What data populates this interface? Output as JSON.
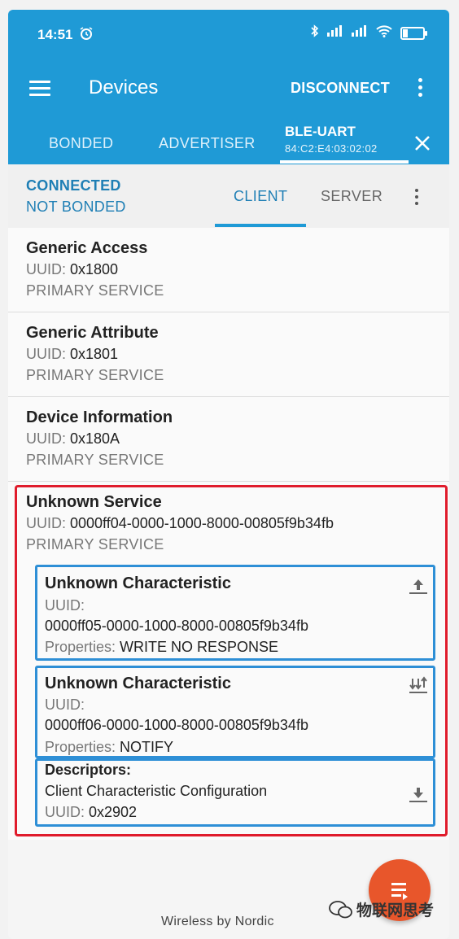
{
  "status_bar": {
    "time": "14:51",
    "battery": "24"
  },
  "app_bar": {
    "title": "Devices",
    "disconnect_label": "DISCONNECT"
  },
  "tabs": {
    "bonded": "BONDED",
    "advertiser": "ADVERTISER",
    "active_device_name": "BLE-UART",
    "active_device_address": "84:C2:E4:03:02:02"
  },
  "connection": {
    "state": "CONNECTED",
    "bond_state": "NOT BONDED",
    "client_tab": "CLIENT",
    "server_tab": "SERVER"
  },
  "services": [
    {
      "name": "Generic Access",
      "uuid_label": "UUID: ",
      "uuid": "0x1800",
      "type": "PRIMARY SERVICE"
    },
    {
      "name": "Generic Attribute",
      "uuid_label": "UUID: ",
      "uuid": "0x1801",
      "type": "PRIMARY SERVICE"
    },
    {
      "name": "Device Information",
      "uuid_label": "UUID: ",
      "uuid": "0x180A",
      "type": "PRIMARY SERVICE"
    },
    {
      "name": "Unknown Service",
      "uuid_label": "UUID: ",
      "uuid": "0000ff04-0000-1000-8000-00805f9b34fb",
      "type": "PRIMARY SERVICE"
    }
  ],
  "characteristics": [
    {
      "name": "Unknown Characteristic",
      "uuid_label": "UUID:",
      "uuid": "0000ff05-0000-1000-8000-00805f9b34fb",
      "properties_label": "Properties: ",
      "properties": "WRITE NO RESPONSE",
      "icon": "upload-arrow-icon"
    },
    {
      "name": "Unknown Characteristic",
      "uuid_label": "UUID:",
      "uuid": "0000ff06-0000-1000-8000-00805f9b34fb",
      "properties_label": "Properties: ",
      "properties": "NOTIFY",
      "icon": "notify-arrows-icon"
    }
  ],
  "descriptor": {
    "heading": "Descriptors:",
    "name": "Client Characteristic Configuration",
    "uuid_label": "UUID: ",
    "uuid": "0x2902",
    "icon": "download-arrow-icon"
  },
  "footer": {
    "text": "Wireless by Nordic"
  },
  "watermark": {
    "text": "物联网思考"
  },
  "colors": {
    "primary": "#1f9ad6",
    "accent": "#e8562b",
    "highlight_red": "#e01c2c",
    "highlight_blue": "#2e8fd6"
  }
}
